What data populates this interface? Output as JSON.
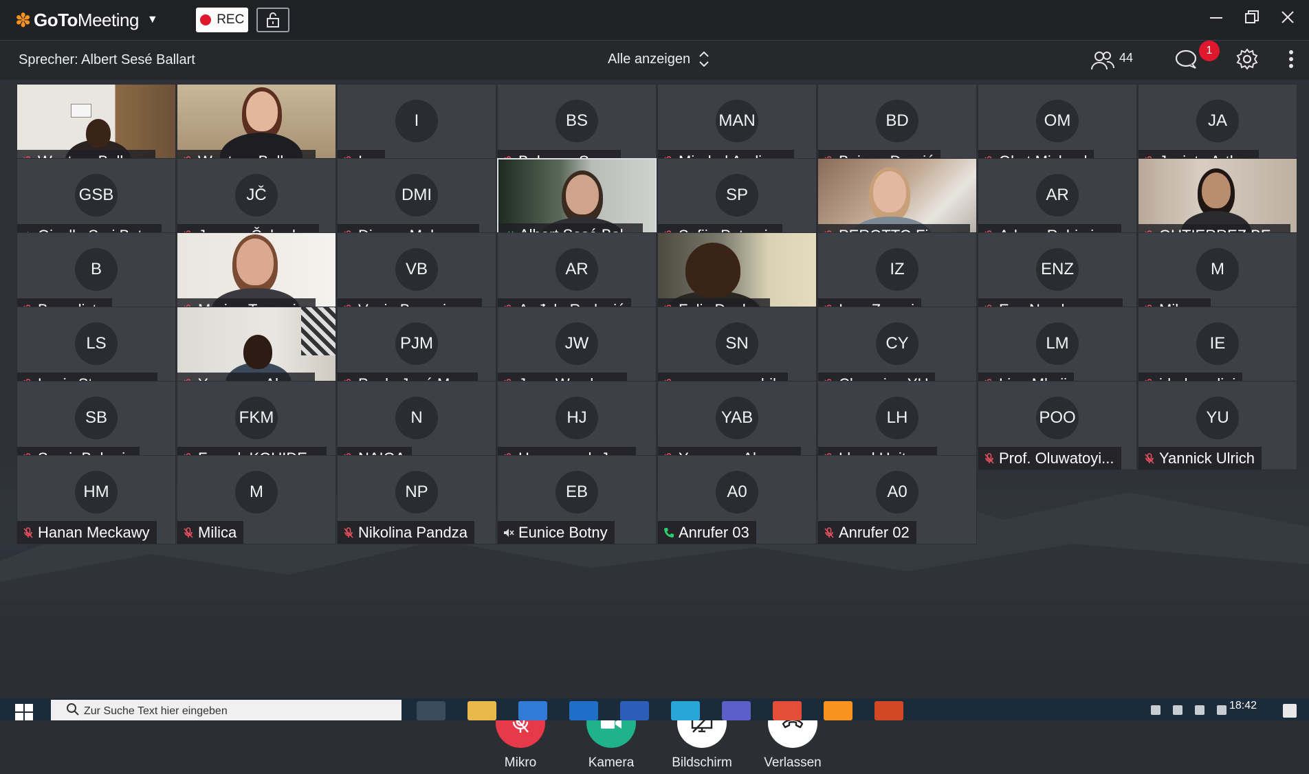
{
  "app": {
    "logo_text_bold": "GoTo",
    "logo_text": "Meeting",
    "rec_label": "REC"
  },
  "toolbar": {
    "speaker_label": "Sprecher: Albert Sesé Ballart",
    "view_label": "Alle anzeigen",
    "participant_count": "44",
    "chat_badge": "1"
  },
  "tiles": [
    {
      "initials": "",
      "name": "Western Balka...",
      "status": "mic-off",
      "video": "room1"
    },
    {
      "initials": "",
      "name": "Western Balka...",
      "status": "mic-off",
      "video": "woman1"
    },
    {
      "initials": "I",
      "name": "Iva",
      "status": "mic-off"
    },
    {
      "initials": "BS",
      "name": "Babacar Sene",
      "status": "mic-off"
    },
    {
      "initials": "MAN",
      "name": "Mirabel Andin ...",
      "status": "mic-off"
    },
    {
      "initials": "BD",
      "name": "Bojana Dragić",
      "status": "mic-off"
    },
    {
      "initials": "OM",
      "name": "Okot Michael",
      "status": "mic-off"
    },
    {
      "initials": "JA",
      "name": "Jacinta Arthur",
      "status": "mic-off"
    },
    {
      "initials": "GSB",
      "name": "Giselle Sari Bot...",
      "status": "speaker-off"
    },
    {
      "initials": "JČ",
      "name": "Jovana Čabark...",
      "status": "mic-off"
    },
    {
      "initials": "DMI",
      "name": "Dinaya Maham...",
      "status": "mic-off"
    },
    {
      "initials": "",
      "name": "Albert Sesé Bal...",
      "status": "speaking",
      "video": "man1",
      "active": true
    },
    {
      "initials": "SP",
      "name": "Sofija Petrovic",
      "status": "mic-off"
    },
    {
      "initials": "",
      "name": "PEROTTO Fiore...",
      "status": "mic-off",
      "video": "woman2"
    },
    {
      "initials": "AR",
      "name": "Adnan Rahimic...",
      "status": "mic-off"
    },
    {
      "initials": "",
      "name": "GUTIERREZ BE...",
      "status": "mic-off",
      "video": "woman3"
    },
    {
      "initials": "B",
      "name": "Benedicte",
      "status": "mic-off"
    },
    {
      "initials": "",
      "name": "Marina Tomovi...",
      "status": "mic-off",
      "video": "woman4"
    },
    {
      "initials": "VB",
      "name": "Vanja Banovic, ...",
      "status": "mic-off"
    },
    {
      "initials": "AR",
      "name": "Anđela Radović",
      "status": "mic-off"
    },
    {
      "initials": "",
      "name": "Felix Donkor",
      "status": "mic-off",
      "video": "man2"
    },
    {
      "initials": "IZ",
      "name": "Ines Zgarni",
      "status": "mic-off"
    },
    {
      "initials": "ENZ",
      "name": "Eva Nambeye -...",
      "status": "mic-off"
    },
    {
      "initials": "M",
      "name": "Milena",
      "status": "mic-off"
    },
    {
      "initials": "LS",
      "name": "Louis Steevenne",
      "status": "mic-off"
    },
    {
      "initials": "",
      "name": "Yamungu Alon...",
      "status": "mic-off",
      "video": "man3"
    },
    {
      "initials": "PJM",
      "name": "Paulo José Mu...",
      "status": "mic-off"
    },
    {
      "initials": "JW",
      "name": "Jane Wambura",
      "status": "mic-off"
    },
    {
      "initials": "SN",
      "name": "soumaya nabih",
      "status": "mic-off"
    },
    {
      "initials": "CY",
      "name": "Chengjun YU",
      "status": "mic-off"
    },
    {
      "initials": "LM",
      "name": "Lina Mkoji",
      "status": "mic-off"
    },
    {
      "initials": "IE",
      "name": "idrak ezdini",
      "status": "mic-off"
    },
    {
      "initials": "SB",
      "name": "Samir Beharic",
      "status": "mic-off"
    },
    {
      "initials": "FKM",
      "name": "Farouk KOUIDE...",
      "status": "mic-off"
    },
    {
      "initials": "N",
      "name": "NAIGA",
      "status": "mic-off"
    },
    {
      "initials": "HJ",
      "name": "Houmayrah Je...",
      "status": "mic-off"
    },
    {
      "initials": "YAB",
      "name": "Yenesew Alene...",
      "status": "mic-off"
    },
    {
      "initials": "LH",
      "name": "Lloyd Huitson",
      "status": "mic-off"
    },
    {
      "initials": "POO",
      "name": "Prof. Oluwatoyi...",
      "status": "mic-off"
    },
    {
      "initials": "YU",
      "name": "Yannick Ulrich",
      "status": "mic-off"
    },
    {
      "initials": "HM",
      "name": "Hanan Meckawy",
      "status": "mic-off"
    },
    {
      "initials": "M",
      "name": "Milica",
      "status": "mic-off"
    },
    {
      "initials": "NP",
      "name": "Nikolina Pandza",
      "status": "mic-off"
    },
    {
      "initials": "EB",
      "name": "Eunice Botny",
      "status": "speaker-off"
    },
    {
      "initials": "A0",
      "name": "Anrufer 03",
      "status": "phone"
    },
    {
      "initials": "A0",
      "name": "Anrufer 02",
      "status": "mic-off"
    }
  ],
  "controls": {
    "mic_label": "Mikro",
    "camera_label": "Kamera",
    "screen_label": "Bildschirm",
    "leave_label": "Verlassen"
  },
  "taskbar": {
    "search_placeholder": "Zur Suche Text hier eingeben",
    "clock": "18:42"
  },
  "colors": {
    "accent_logo": "#f7931e",
    "rec_red": "#e0182d",
    "mic_red": "#e6394a",
    "camera_green": "#20b28a",
    "speaking_green": "#2ecc71"
  }
}
